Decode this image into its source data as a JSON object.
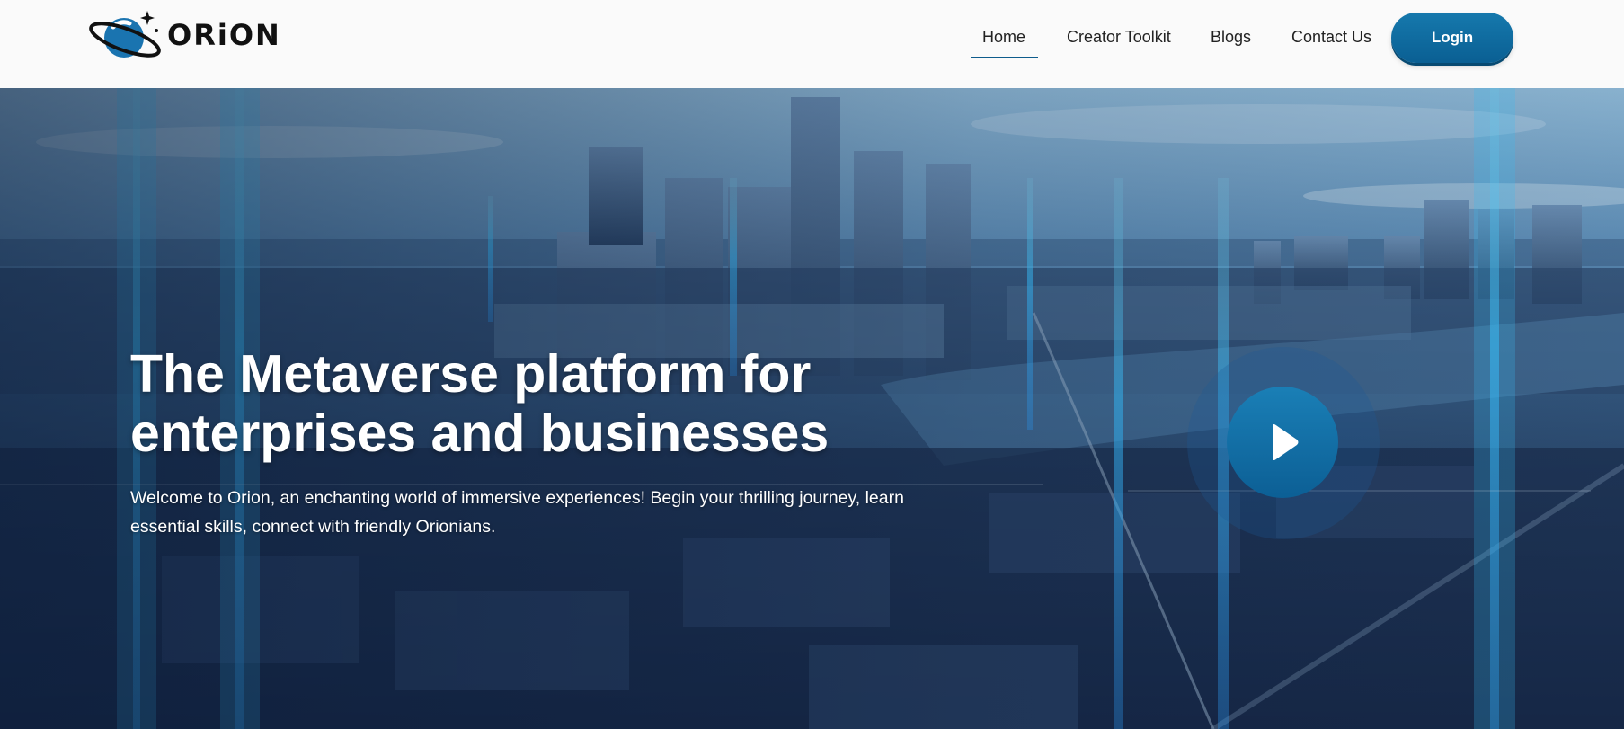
{
  "brand": {
    "name": "ORiON"
  },
  "nav": {
    "items": [
      {
        "label": "Home",
        "active": true
      },
      {
        "label": "Creator Toolkit"
      },
      {
        "label": "Blogs"
      },
      {
        "label": "Contact Us"
      }
    ],
    "login_label": "Login"
  },
  "hero": {
    "title_line1": "The Metaverse platform for",
    "title_line2": "enterprises and businesses",
    "description_line1": "Welcome to Orion, an enchanting world of immersive experiences! Begin your thrilling journey, learn",
    "description_line2": "essential skills, connect with friendly Orionians.",
    "play_icon": "play-icon"
  },
  "colors": {
    "accent": "#0e6aa0",
    "accent_dark": "#0a5f93",
    "header_bg": "#fafafa",
    "text_dark": "#222222"
  }
}
